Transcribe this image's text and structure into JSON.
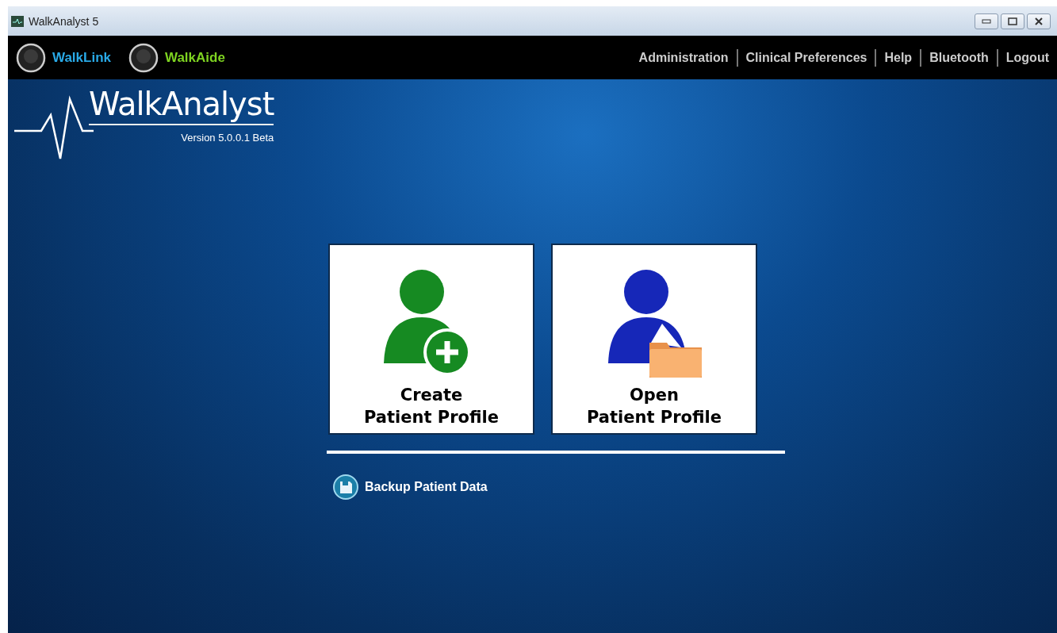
{
  "window": {
    "title": "WalkAnalyst 5"
  },
  "devices": [
    {
      "label": "WalkLink",
      "color": "#29a9e6"
    },
    {
      "label": "WalkAide",
      "color": "#7ed321"
    }
  ],
  "menu": [
    "Administration",
    "Clinical Preferences",
    "Help",
    "Bluetooth",
    "Logout"
  ],
  "logo": {
    "name": "WalkAnalyst",
    "version": "Version 5.0.0.1 Beta"
  },
  "tiles": [
    {
      "kind": "create",
      "lines": [
        "Create",
        "Patient Profile"
      ]
    },
    {
      "kind": "open",
      "lines": [
        "Open",
        "Patient Profile"
      ]
    }
  ],
  "backup": {
    "label": "Backup Patient Data"
  }
}
